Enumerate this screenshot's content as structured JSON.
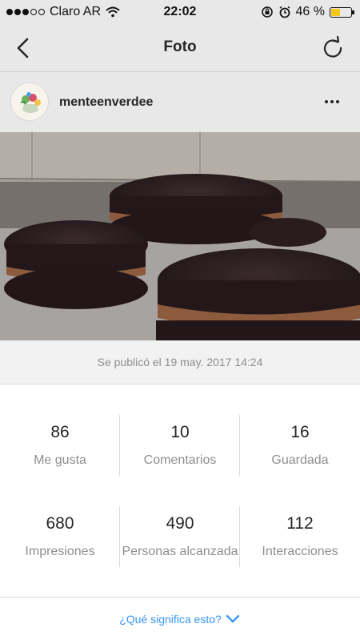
{
  "status_bar": {
    "carrier": "Claro AR",
    "time": "22:02",
    "battery_percent": "46 %",
    "battery_level": 0.46,
    "battery_color": "#f5c518",
    "signal_full": 3,
    "signal_total": 5
  },
  "nav": {
    "title": "Foto",
    "back_icon": "chevron-left-icon",
    "refresh_icon": "refresh-icon"
  },
  "post": {
    "username": "menteenverdee",
    "more_icon": "ellipsis-icon",
    "published": "Se publicó el 19 may. 2017 14:24"
  },
  "stats": [
    {
      "value": "86",
      "label": "Me gusta"
    },
    {
      "value": "10",
      "label": "Comentarios"
    },
    {
      "value": "16",
      "label": "Guardada"
    },
    {
      "value": "680",
      "label": "Impresiones"
    },
    {
      "value": "490",
      "label": "Personas alcanzada"
    },
    {
      "value": "112",
      "label": "Interacciones"
    }
  ],
  "footer": {
    "help_link": "¿Qué significa esto?",
    "help_icon": "chevron-down-icon",
    "accent_color": "#3897f0"
  }
}
